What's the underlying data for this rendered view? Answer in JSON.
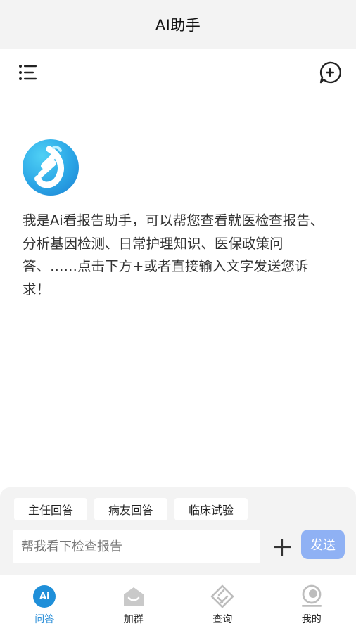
{
  "header": {
    "title": "AI助手"
  },
  "toolbar": {
    "menu_icon": "list-menu-icon",
    "new_chat_icon": "chat-plus-icon"
  },
  "assistant": {
    "logo_icon": "assistant-logo-icon",
    "intro": "我是Ai看报告助手，可以帮您查看就医检查报告、分析基因检测、日常护理知识、医保政策问答、……点击下方+或者直接输入文字发送您诉求！"
  },
  "quick_replies": [
    {
      "label": "主任回答"
    },
    {
      "label": "病友回答"
    },
    {
      "label": "临床试验"
    }
  ],
  "composer": {
    "placeholder": "帮我看下检查报告",
    "plus_icon": "plus-icon",
    "send_label": "发送",
    "send_color": "#8fb1f4"
  },
  "tabs": [
    {
      "label": "问答",
      "icon": "ai-chat-icon",
      "badge": "Ai",
      "active": true
    },
    {
      "label": "加群",
      "icon": "group-house-icon",
      "active": false
    },
    {
      "label": "查询",
      "icon": "search-diamond-icon",
      "active": false
    },
    {
      "label": "我的",
      "icon": "profile-icon",
      "active": false
    }
  ],
  "colors": {
    "accent": "#1f8fd9",
    "panel_bg": "#f3f3f3",
    "title_bg": "#f3f3f3"
  }
}
